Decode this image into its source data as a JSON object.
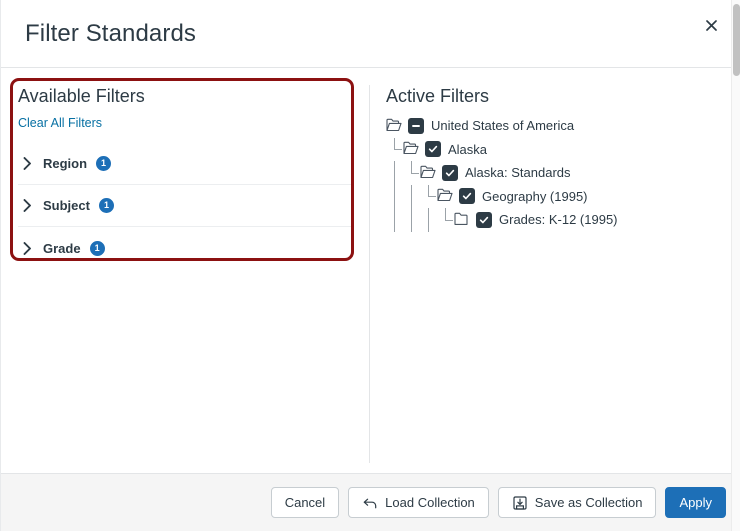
{
  "dialog": {
    "title": "Filter Standards",
    "close_label": "×",
    "close_icon": "close-icon"
  },
  "available_filters": {
    "heading": "Available Filters",
    "clear_all_label": "Clear All Filters",
    "highlight_color": "#8C1111",
    "badge_color": "#1D6FB7",
    "link_color": "#0770A3",
    "items": [
      {
        "label": "Region",
        "count": "1",
        "expanded": false,
        "icon": "chevron-right-icon"
      },
      {
        "label": "Subject",
        "count": "1",
        "expanded": false,
        "icon": "chevron-right-icon"
      },
      {
        "label": "Grade",
        "count": "1",
        "expanded": false,
        "icon": "chevron-right-icon"
      }
    ]
  },
  "active_filters": {
    "heading": "Active Filters",
    "tree": [
      {
        "label": "United States of America",
        "depth": 0,
        "checkbox": "indeterminate",
        "folder": "folder-open-icon"
      },
      {
        "label": "Alaska",
        "depth": 1,
        "checkbox": "checked",
        "folder": "folder-open-icon"
      },
      {
        "label": "Alaska: Standards",
        "depth": 2,
        "checkbox": "checked",
        "folder": "folder-open-icon"
      },
      {
        "label": "Geography (1995)",
        "depth": 3,
        "checkbox": "checked",
        "folder": "folder-open-icon"
      },
      {
        "label": "Grades: K-12 (1995)",
        "depth": 4,
        "checkbox": "checked",
        "folder": "folder-closed-icon"
      }
    ]
  },
  "footer": {
    "buttons": [
      {
        "label": "Cancel",
        "style": "secondary",
        "icon": null
      },
      {
        "label": "Load Collection",
        "style": "secondary",
        "icon": "arrow-undo-icon"
      },
      {
        "label": "Save as Collection",
        "style": "secondary",
        "icon": "save-disk-icon"
      },
      {
        "label": "Apply",
        "style": "primary",
        "icon": null
      }
    ],
    "primary_color": "#1D6FB7"
  }
}
